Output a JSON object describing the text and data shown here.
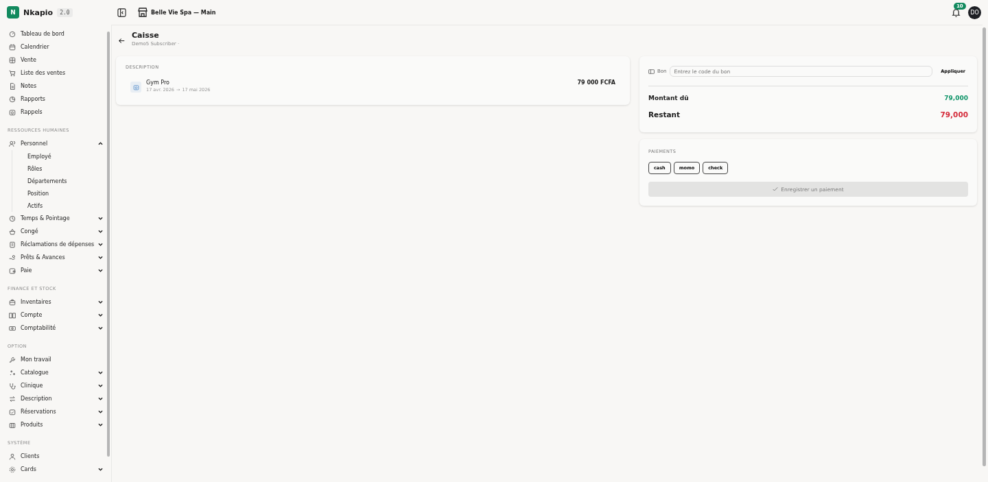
{
  "brand": {
    "logo_letter": "N",
    "name": "Nkapio",
    "version": "2.0"
  },
  "header": {
    "store": "Belle Vie Spa — Main",
    "notifications": "10",
    "avatar": "DO"
  },
  "sidebar": {
    "sections": [
      {
        "items": [
          {
            "kind": "link",
            "label": "Tableau de bord"
          },
          {
            "kind": "link",
            "label": "Calendrier"
          },
          {
            "kind": "link",
            "label": "Vente"
          },
          {
            "kind": "link",
            "label": "Liste des ventes"
          },
          {
            "kind": "link",
            "label": "Notes"
          },
          {
            "kind": "link",
            "label": "Rapports"
          },
          {
            "kind": "link",
            "label": "Rappels"
          }
        ]
      },
      {
        "title": "RESSOURCES HUMAINES",
        "items": [
          {
            "kind": "group",
            "label": "Personnel",
            "expanded": true,
            "children": [
              {
                "label": "Employé"
              },
              {
                "label": "Rôles"
              },
              {
                "label": "Départements"
              },
              {
                "label": "Position"
              },
              {
                "label": "Actifs"
              }
            ]
          },
          {
            "kind": "group",
            "label": "Temps & Pointage",
            "expanded": false
          },
          {
            "kind": "group",
            "label": "Congé",
            "expanded": false
          },
          {
            "kind": "group",
            "label": "Réclamations de dépenses",
            "expanded": false
          },
          {
            "kind": "group",
            "label": "Prêts & Avances",
            "expanded": false
          },
          {
            "kind": "group",
            "label": "Paie",
            "expanded": false
          }
        ]
      },
      {
        "title": "FINANCE ET STOCK",
        "items": [
          {
            "kind": "group",
            "label": "Inventaires",
            "expanded": false
          },
          {
            "kind": "group",
            "label": "Compte",
            "expanded": false
          },
          {
            "kind": "group",
            "label": "Comptabilité",
            "expanded": false
          }
        ]
      },
      {
        "title": "OPTION",
        "items": [
          {
            "kind": "link",
            "label": "Mon travail"
          },
          {
            "kind": "group",
            "label": "Catalogue",
            "expanded": false
          },
          {
            "kind": "group",
            "label": "Clinique",
            "expanded": false
          },
          {
            "kind": "group",
            "label": "Description",
            "expanded": false
          },
          {
            "kind": "group",
            "label": "Réservations",
            "expanded": false
          },
          {
            "kind": "group",
            "label": "Produits",
            "expanded": false
          }
        ]
      },
      {
        "title": "SYSTÈME",
        "items": [
          {
            "kind": "link",
            "label": "Clients"
          },
          {
            "kind": "group",
            "label": "Cards",
            "expanded": false
          }
        ]
      }
    ]
  },
  "page": {
    "title": "Caisse",
    "subtitle": "Demo5 Subscriber ·"
  },
  "description": {
    "heading": "DESCRIPTION",
    "lines": [
      {
        "name": "Gym Pro",
        "start": "17 avr. 2026",
        "arrow": "→",
        "end": "17 mai 2026",
        "amount": "79 000 FCFA"
      }
    ]
  },
  "voucher": {
    "label": "Bon",
    "placeholder": "Entrez le code du bon",
    "apply": "Appliquer"
  },
  "totals": [
    {
      "label": "Montant dû",
      "value": "79,000",
      "color": "#13966b"
    },
    {
      "label": "Restant",
      "value": "79,000",
      "color": "#d42b3a"
    }
  ],
  "payments": {
    "heading": "PAIEMENTS",
    "methods": [
      {
        "label": "cash",
        "selected": false
      },
      {
        "label": "momo",
        "selected": false
      },
      {
        "label": "check",
        "selected": false
      }
    ],
    "submit": {
      "label": "Enregistrer un paiement",
      "disabled": true
    }
  }
}
